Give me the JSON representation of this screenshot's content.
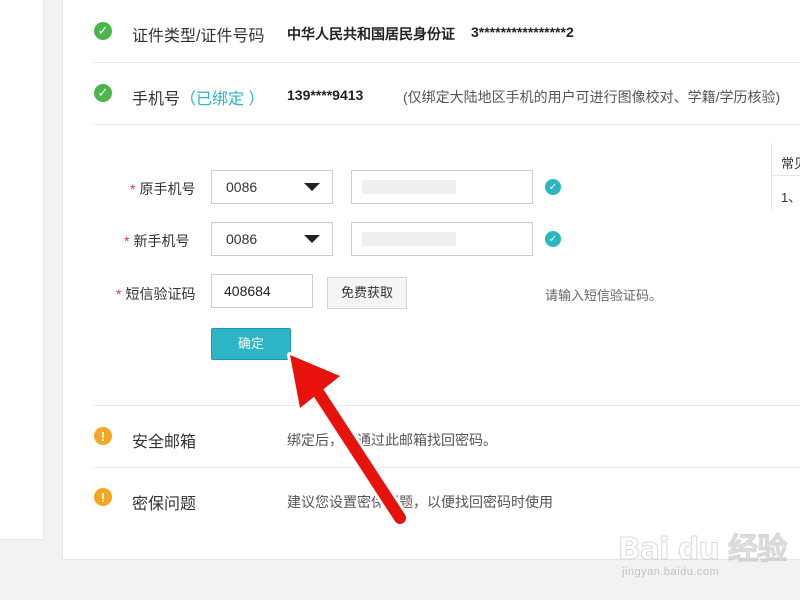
{
  "rows": {
    "id_card": {
      "title": "证件类型/证件号码",
      "value": "中华人民共和国居民身份证",
      "number": "3****************2"
    },
    "phone": {
      "title": "手机号",
      "status": "（已绑定 ）",
      "value": "139****9413",
      "note": "(仅绑定大陆地区手机的用户可进行图像校对、学籍/学历核验)"
    },
    "email": {
      "title": "安全邮箱",
      "note": "绑定后，可通过此邮箱找回密码。"
    },
    "security_question": {
      "title": "密保问题",
      "note": "建议您设置密保问题，以便找回密码时使用"
    }
  },
  "form": {
    "required_mark": "*",
    "old_phone_label": "原手机号",
    "new_phone_label": "新手机号",
    "sms_label": "短信验证码",
    "country_code_old": "0086",
    "country_code_new": "0086",
    "sms_code": "408684",
    "get_code_button": "免费获取",
    "sms_hint": "请输入短信验证码。",
    "confirm_button": "确定"
  },
  "side": {
    "title": "常见",
    "item": "1、"
  },
  "watermark": {
    "logo": "Bai du 经验",
    "url": "jingyan.baidu.com"
  },
  "colors": {
    "accent": "#2bb5c5",
    "ok": "#4cb64c",
    "warn": "#f5a623",
    "arrow": "#e8120c",
    "required": "#ee3333"
  }
}
